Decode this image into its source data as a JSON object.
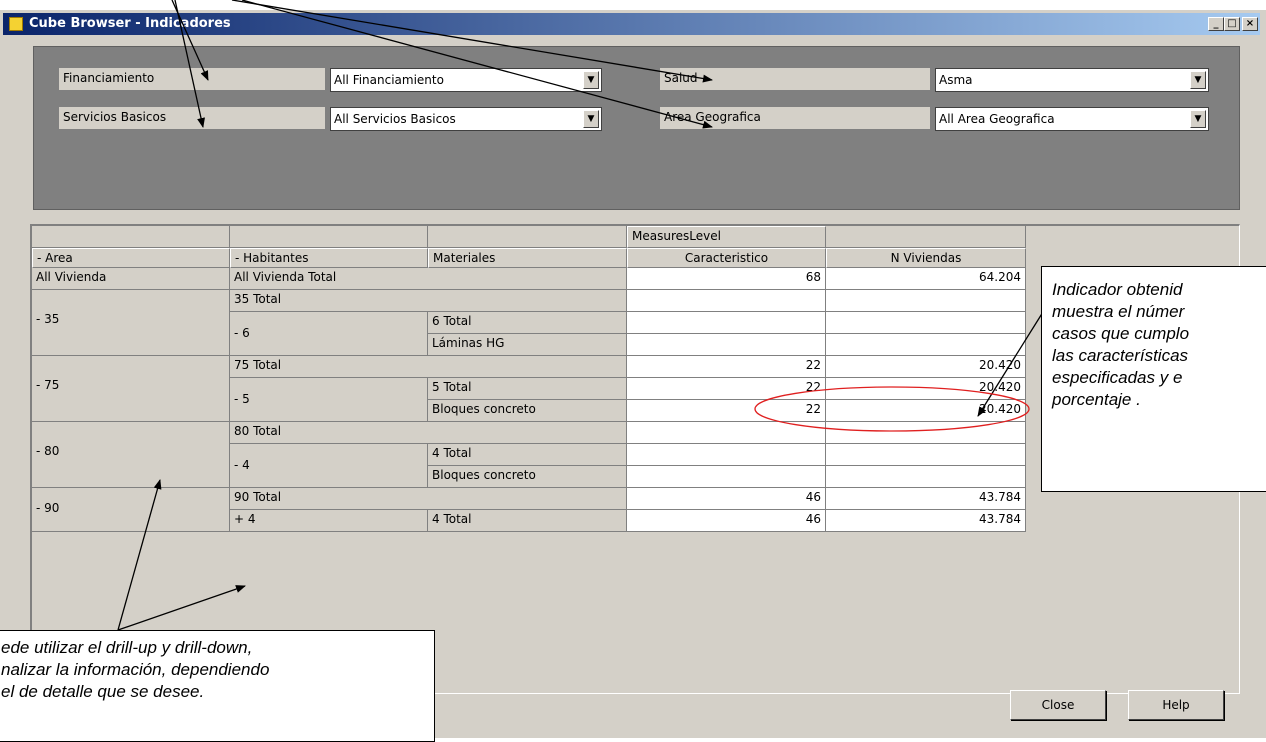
{
  "window": {
    "title": "Cube Browser - Indicadores",
    "min_glyph": "_",
    "max_glyph": "□",
    "close_glyph": "×"
  },
  "filters": [
    {
      "label": "Financiamiento",
      "value": "All Financiamiento"
    },
    {
      "label": "Servicios Basicos",
      "value": "All Servicios Basicos"
    },
    {
      "label": "Salud",
      "value": "Asma"
    },
    {
      "label": "Area Geografica",
      "value": "All Area Geografica"
    }
  ],
  "dropdown_arrow": "▼",
  "grid": {
    "measures_level": "MeasuresLevel",
    "row_headers": [
      "- Area",
      "- Habitantes",
      "Materiales"
    ],
    "measure_headers": [
      "Caracteristico",
      "N Viviendas"
    ],
    "rows": [
      {
        "area": "All Vivienda",
        "habitantes": "All Vivienda Total",
        "materiales": "",
        "caracteristico": "68",
        "viviendas": "64.204"
      },
      {
        "area": "- 35",
        "habitantes": "35 Total",
        "materiales": "",
        "caracteristico": "",
        "viviendas": ""
      },
      {
        "area": "",
        "habitantes": "- 6",
        "materiales": "6 Total",
        "caracteristico": "",
        "viviendas": ""
      },
      {
        "area": "",
        "habitantes": "",
        "materiales": "Láminas HG",
        "caracteristico": "",
        "viviendas": ""
      },
      {
        "area": "- 75",
        "habitantes": "75 Total",
        "materiales": "",
        "caracteristico": "22",
        "viviendas": "20.420"
      },
      {
        "area": "",
        "habitantes": "- 5",
        "materiales": "5 Total",
        "caracteristico": "22",
        "viviendas": "20.420"
      },
      {
        "area": "",
        "habitantes": "",
        "materiales": "Bloques concreto",
        "caracteristico": "22",
        "viviendas": "20.420"
      },
      {
        "area": "- 80",
        "habitantes": "80 Total",
        "materiales": "",
        "caracteristico": "",
        "viviendas": ""
      },
      {
        "area": "",
        "habitantes": "- 4",
        "materiales": "4 Total",
        "caracteristico": "",
        "viviendas": ""
      },
      {
        "area": "",
        "habitantes": "",
        "materiales": "Bloques concreto",
        "caracteristico": "",
        "viviendas": ""
      },
      {
        "area": "- 90",
        "habitantes": "90 Total",
        "materiales": "",
        "caracteristico": "46",
        "viviendas": "43.784"
      },
      {
        "area": "",
        "habitantes": "+ 4",
        "materiales": "4 Total",
        "caracteristico": "46",
        "viviendas": "43.784"
      }
    ]
  },
  "buttons": {
    "close": "Close",
    "help": "Help"
  },
  "annotations": {
    "right_callout": [
      "Indicador obtenid",
      "muestra el númer",
      "casos que cumplo",
      "las características",
      "especificadas y e",
      "porcentaje ."
    ],
    "bottom_callout": [
      "ede utilizar el drill-up y drill-down,",
      "nalizar la información, dependiendo",
      "el de detalle que se desee."
    ]
  },
  "colors": {
    "titlebar_start": "#0a246a",
    "titlebar_end": "#a6caf0",
    "window_bg": "#d4d0c8",
    "filter_panel_bg": "#808080",
    "highlight_ellipse": "#e02020"
  }
}
